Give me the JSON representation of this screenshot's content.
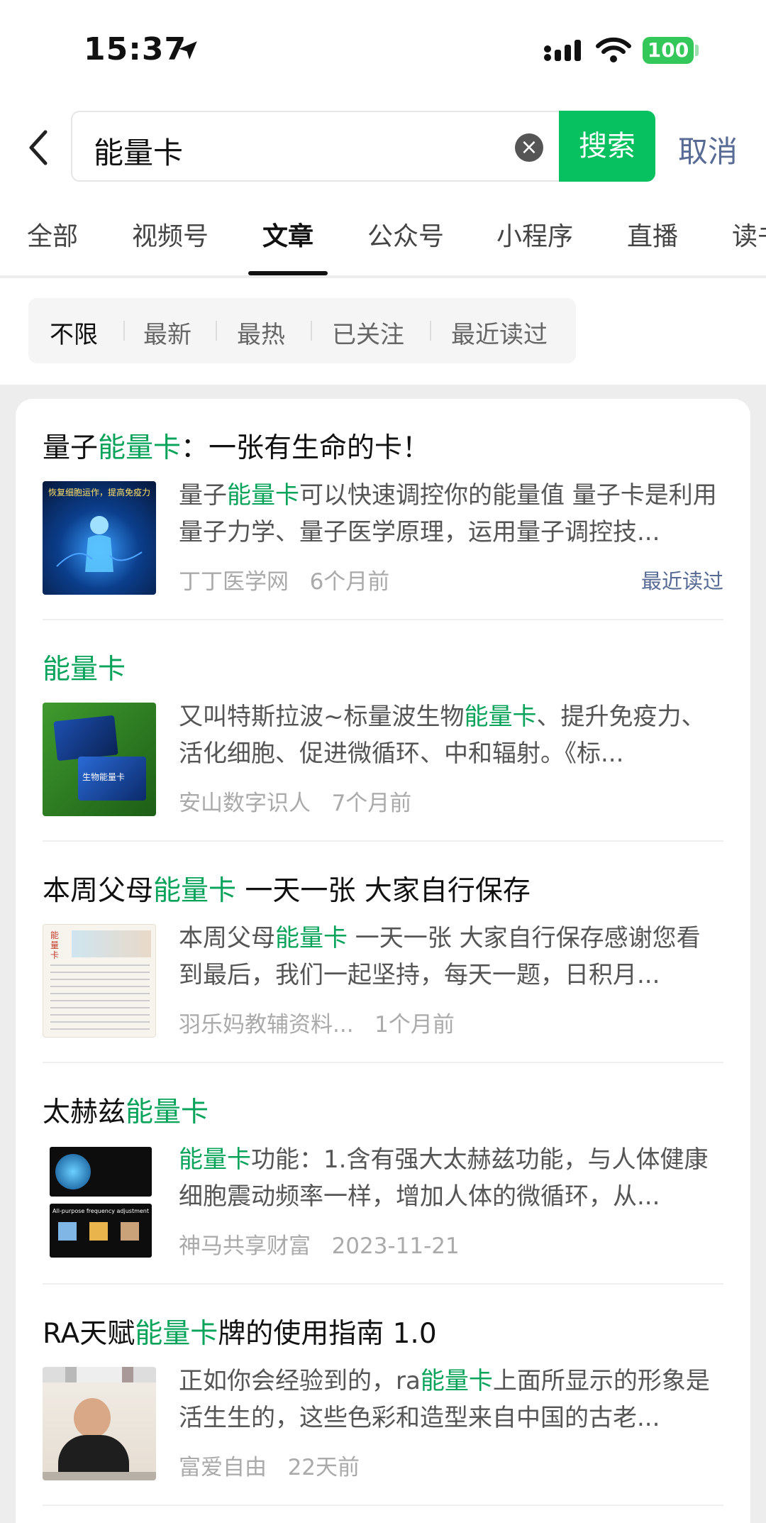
{
  "status_bar": {
    "time": "15:37",
    "battery": "100"
  },
  "search": {
    "query": "能量卡",
    "button": "搜索",
    "cancel": "取消"
  },
  "tabs": [
    "全部",
    "视频号",
    "文章",
    "公众号",
    "小程序",
    "直播",
    "读书"
  ],
  "active_tab": "文章",
  "filters": [
    "不限",
    "最新",
    "最热",
    "已关注",
    "最近读过"
  ],
  "results": [
    {
      "title_pre": "量子",
      "title_hl": "能量卡",
      "title_post": "：一张有生命的卡！",
      "desc_pre": "量子",
      "desc_hl": "能量卡",
      "desc_post": "可以快速调控你的能量值 量子卡是利用量子力学、量子医学原理，运用量子调控技...",
      "source": "丁丁医学网",
      "time": "6个月前",
      "badge": "最近读过",
      "thumb_caption": "恢复细胞运作，提高免疫力"
    },
    {
      "title_pre": "",
      "title_hl": "能量卡",
      "title_post": "",
      "desc_pre": "又叫特斯拉波~标量波生物",
      "desc_hl": "能量卡",
      "desc_post": "、提升免疫力、活化细胞、促进微循环、中和辐射。《标...",
      "source": "安山数字识人",
      "time": "7个月前",
      "badge": "",
      "thumb_caption": "生物能量卡"
    },
    {
      "title_pre": "本周父母",
      "title_hl": "能量卡",
      "title_post": " 一天一张 大家自行保存",
      "desc_pre": "本周父母",
      "desc_hl": "能量卡",
      "desc_post": " 一天一张 大家自行保存感谢您看到最后，我们一起坚持，每天一题，日积月...",
      "source": "羽乐妈教辅资料...",
      "time": "1个月前",
      "badge": "",
      "thumb_caption": "能量卡"
    },
    {
      "title_pre": "太赫兹",
      "title_hl": "能量卡",
      "title_post": "",
      "desc_pre": "",
      "desc_hl": "能量卡",
      "desc_post": "功能：1.含有强大太赫兹功能，与人体健康细胞震动频率一样，增加人体的微循环，从...",
      "source": "神马共享财富",
      "time": "2023-11-21",
      "badge": "",
      "thumb_caption": "All-purpose frequency adjustment"
    },
    {
      "title_pre": "RA天赋",
      "title_hl": "能量卡",
      "title_post": "牌的使用指南 1.0",
      "desc_pre": "正如你会经验到的，ra",
      "desc_hl": "能量卡",
      "desc_post": "上面所显示的形象是活生生的，这些色彩和造型来自中国的古老...",
      "source": "富爱自由",
      "time": "22天前",
      "badge": "",
      "thumb_caption": ""
    }
  ],
  "colors": {
    "accent": "#07c160",
    "highlight": "#07a35a",
    "link": "#576b95"
  }
}
